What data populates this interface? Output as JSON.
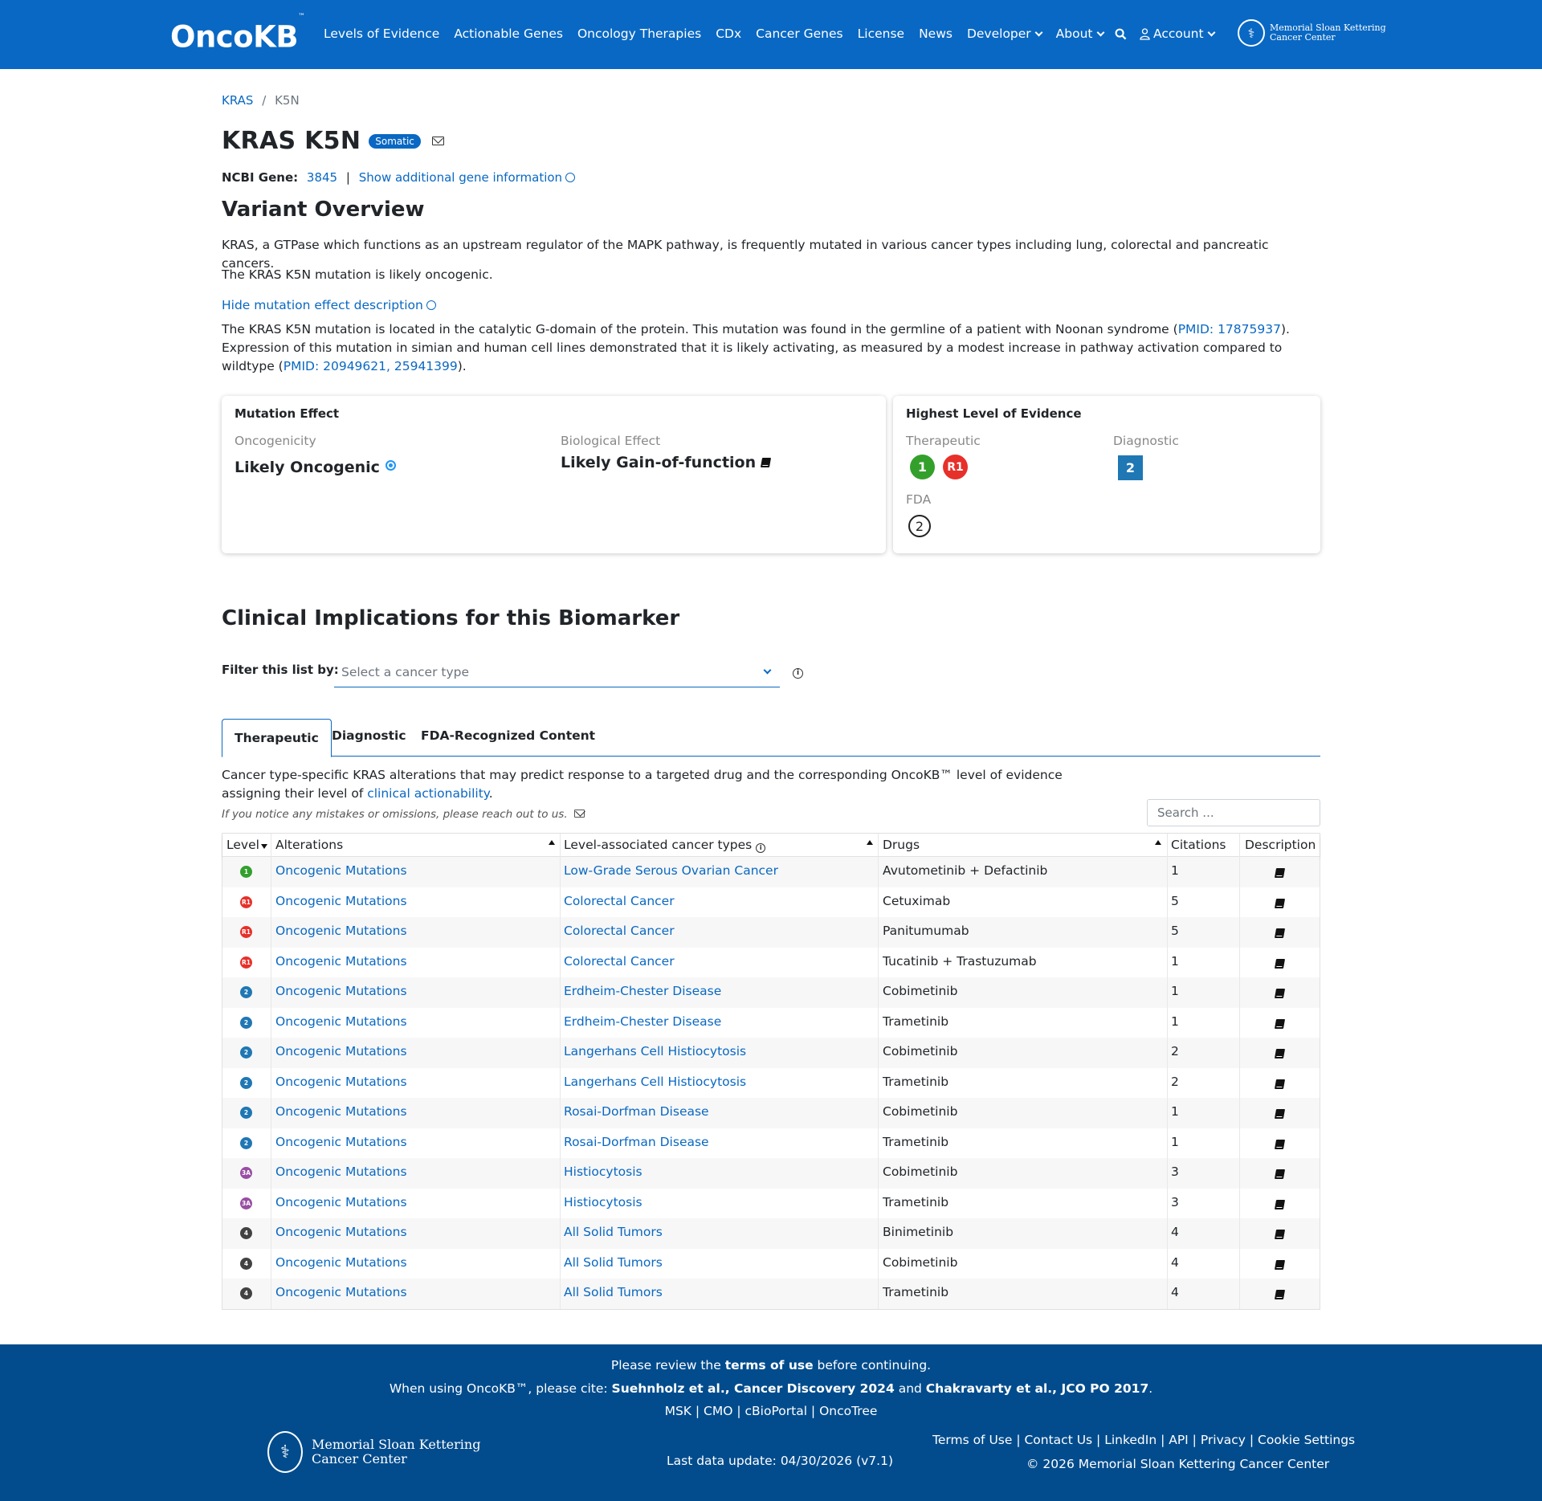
{
  "nav": {
    "logo": "OncoKB",
    "logo_tm": "™",
    "links": [
      "Levels of Evidence",
      "Actionable Genes",
      "Oncology Therapies",
      "CDx",
      "Cancer Genes",
      "License",
      "News",
      "Developer",
      "About"
    ],
    "account": "Account",
    "msk_line1": "Memorial Sloan Kettering",
    "msk_line2": "Cancer Center"
  },
  "breadcrumb": {
    "gene": "KRAS",
    "sep": "/",
    "alteration": "K5N"
  },
  "header": {
    "title": "KRAS K5N",
    "badge": "Somatic",
    "ncbi_label": "NCBI Gene:",
    "ncbi_id": "3845",
    "sep": "|",
    "show_more": "Show additional gene information"
  },
  "overview": {
    "heading": "Variant Overview",
    "gene_summary": "KRAS, a GTPase which functions as an upstream regulator of the MAPK pathway, is frequently mutated in various cancer types including lung, colorectal and pancreatic cancers.",
    "variant_summary": "The KRAS K5N mutation is likely oncogenic.",
    "toggle": "Hide mutation effect description",
    "desc_1": "The KRAS K5N mutation is located in the catalytic G-domain of the protein. This mutation was found in the germline of a patient with Noonan syndrome (",
    "pmid_1": "PMID: 17875937",
    "desc_2": "). Expression of this mutation in simian and human cell lines demonstrated that it is likely activating, as measured by a modest increase in pathway activation compared to wildtype (",
    "pmid_2": "PMID: 20949621, 25941399",
    "desc_3": ")."
  },
  "mutation_effect": {
    "title": "Mutation Effect",
    "oncogenicity_label": "Oncogenicity",
    "oncogenicity": "Likely Oncogenic",
    "bio_label": "Biological Effect",
    "bio_effect": "Likely Gain-of-function"
  },
  "highest_level": {
    "title": "Highest Level of Evidence",
    "therapeutic_label": "Therapeutic",
    "therapeutic_levels": [
      "1",
      "R1"
    ],
    "diagnostic_label": "Diagnostic",
    "diagnostic_level": "2",
    "fda_label": "FDA",
    "fda_level": "2"
  },
  "clinical": {
    "heading": "Clinical Implications for this Biomarker",
    "filter_label": "Filter this list by:",
    "filter_placeholder": "Select a cancer type",
    "tabs": [
      "Therapeutic",
      "Diagnostic",
      "FDA-Recognized Content"
    ],
    "desc_1": "Cancer type-specific KRAS alterations that may predict response to a targeted drug and the corresponding OncoKB™ level of evidence",
    "desc_2": "assigning their level of ",
    "desc_link": "clinical actionability",
    "desc_end": ".",
    "notice": "If you notice any mistakes or omissions, please reach out to us.",
    "search_placeholder": "Search ..."
  },
  "table": {
    "headers": [
      "Level",
      "Alterations",
      "Level-associated cancer types",
      "Drugs",
      "Citations",
      "Description"
    ],
    "rows": [
      {
        "level": "1",
        "alteration": "Oncogenic Mutations",
        "cancer": "Low-Grade Serous Ovarian Cancer",
        "drugs": "Avutometinib + Defactinib",
        "citations": "1"
      },
      {
        "level": "R1",
        "alteration": "Oncogenic Mutations",
        "cancer": "Colorectal Cancer",
        "drugs": "Cetuximab",
        "citations": "5"
      },
      {
        "level": "R1",
        "alteration": "Oncogenic Mutations",
        "cancer": "Colorectal Cancer",
        "drugs": "Panitumumab",
        "citations": "5"
      },
      {
        "level": "R1",
        "alteration": "Oncogenic Mutations",
        "cancer": "Colorectal Cancer",
        "drugs": "Tucatinib + Trastuzumab",
        "citations": "1"
      },
      {
        "level": "2",
        "alteration": "Oncogenic Mutations",
        "cancer": "Erdheim-Chester Disease",
        "drugs": "Cobimetinib",
        "citations": "1"
      },
      {
        "level": "2",
        "alteration": "Oncogenic Mutations",
        "cancer": "Erdheim-Chester Disease",
        "drugs": "Trametinib",
        "citations": "1"
      },
      {
        "level": "2",
        "alteration": "Oncogenic Mutations",
        "cancer": "Langerhans Cell Histiocytosis",
        "drugs": "Cobimetinib",
        "citations": "2"
      },
      {
        "level": "2",
        "alteration": "Oncogenic Mutations",
        "cancer": "Langerhans Cell Histiocytosis",
        "drugs": "Trametinib",
        "citations": "2"
      },
      {
        "level": "2",
        "alteration": "Oncogenic Mutations",
        "cancer": "Rosai-Dorfman Disease",
        "drugs": "Cobimetinib",
        "citations": "1"
      },
      {
        "level": "2",
        "alteration": "Oncogenic Mutations",
        "cancer": "Rosai-Dorfman Disease",
        "drugs": "Trametinib",
        "citations": "1"
      },
      {
        "level": "3A",
        "alteration": "Oncogenic Mutations",
        "cancer": "Histiocytosis",
        "drugs": "Cobimetinib",
        "citations": "3"
      },
      {
        "level": "3A",
        "alteration": "Oncogenic Mutations",
        "cancer": "Histiocytosis",
        "drugs": "Trametinib",
        "citations": "3"
      },
      {
        "level": "4",
        "alteration": "Oncogenic Mutations",
        "cancer": "All Solid Tumors",
        "drugs": "Binimetinib",
        "citations": "4"
      },
      {
        "level": "4",
        "alteration": "Oncogenic Mutations",
        "cancer": "All Solid Tumors",
        "drugs": "Cobimetinib",
        "citations": "4"
      },
      {
        "level": "4",
        "alteration": "Oncogenic Mutations",
        "cancer": "All Solid Tumors",
        "drugs": "Trametinib",
        "citations": "4"
      }
    ]
  },
  "level_colors": {
    "1": "#33a02c",
    "R1": "#e7302a",
    "2": "#1f77b4",
    "3A": "#984ea3",
    "4": "#424242"
  },
  "footer": {
    "review_1": "Please review the ",
    "review_terms": "terms of use",
    "review_2": " before continuing.",
    "cite_1": "When using OncoKB™, please cite: ",
    "cite_a": "Suehnholz et al., Cancer Discovery 2024",
    "cite_and": " and ",
    "cite_b": "Chakravarty et al., JCO PO 2017",
    "cite_end": ".",
    "links_center": "MSK | CMO | cBioPortal | OncoTree",
    "msk_line1": "Memorial Sloan Kettering",
    "msk_line2": "Cancer Center",
    "last_update": "Last data update: 04/30/2026 (v7.1)",
    "links_right": "Terms of Use | Contact Us | LinkedIn | API | Privacy | Cookie Settings",
    "copyright": "© 2026 Memorial Sloan Kettering Cancer Center"
  }
}
